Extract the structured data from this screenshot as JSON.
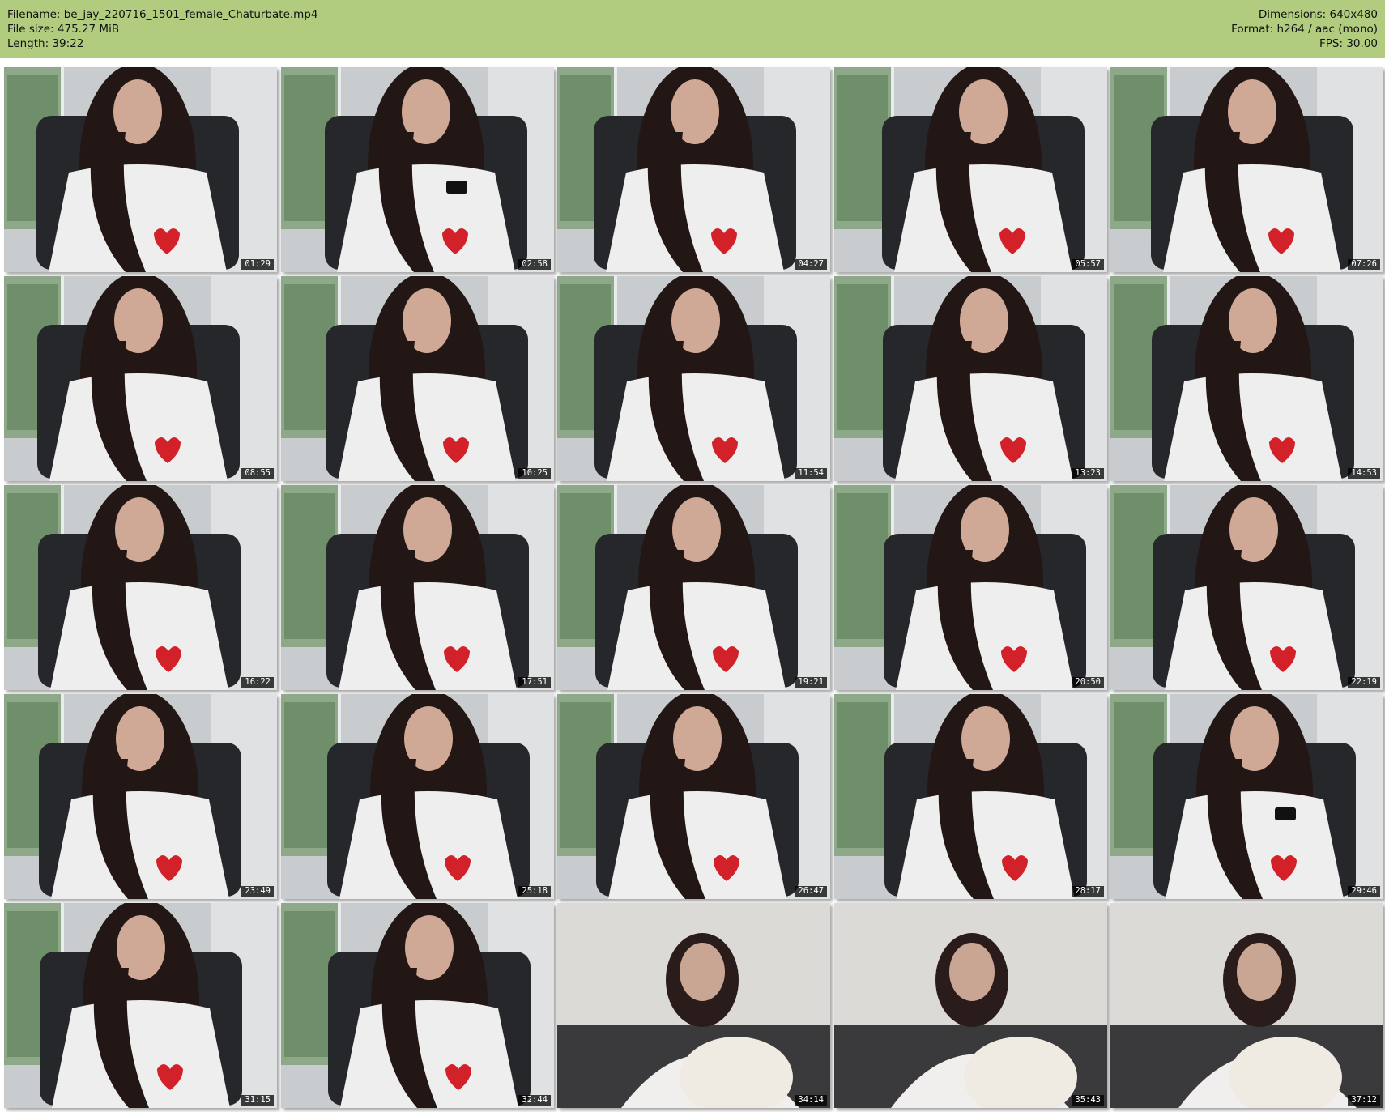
{
  "header": {
    "filename_line": "Filename: be_jay_220716_1501_female_Chaturbate.mp4",
    "filesize_line": "File size: 475.27 MiB",
    "length_line": "Length: 39:22",
    "dimensions_line": "Dimensions: 640x480",
    "format_line": "Format: h264 / aac (mono)",
    "fps_line": "FPS: 30.00",
    "background_color": "#b1cc7f"
  },
  "thumbnails": [
    {
      "time": "01:29",
      "scene": "shirt"
    },
    {
      "time": "02:58",
      "scene": "phone"
    },
    {
      "time": "04:27",
      "scene": "shirt"
    },
    {
      "time": "05:57",
      "scene": "shirt"
    },
    {
      "time": "07:26",
      "scene": "shirt"
    },
    {
      "time": "08:55",
      "scene": "shirt"
    },
    {
      "time": "10:25",
      "scene": "shirt"
    },
    {
      "time": "11:54",
      "scene": "shirt"
    },
    {
      "time": "13:23",
      "scene": "shirt"
    },
    {
      "time": "14:53",
      "scene": "shirt"
    },
    {
      "time": "16:22",
      "scene": "shirt"
    },
    {
      "time": "17:51",
      "scene": "shirt"
    },
    {
      "time": "19:21",
      "scene": "shirt"
    },
    {
      "time": "20:50",
      "scene": "shirt"
    },
    {
      "time": "22:19",
      "scene": "shirt"
    },
    {
      "time": "23:49",
      "scene": "shirt"
    },
    {
      "time": "25:18",
      "scene": "shirt"
    },
    {
      "time": "26:47",
      "scene": "shirt"
    },
    {
      "time": "28:17",
      "scene": "shirt"
    },
    {
      "time": "29:46",
      "scene": "phone"
    },
    {
      "time": "31:15",
      "scene": "shirt"
    },
    {
      "time": "32:44",
      "scene": "shirt"
    },
    {
      "time": "34:14",
      "scene": "bed"
    },
    {
      "time": "35:43",
      "scene": "bed"
    },
    {
      "time": "37:12",
      "scene": "bed"
    }
  ]
}
